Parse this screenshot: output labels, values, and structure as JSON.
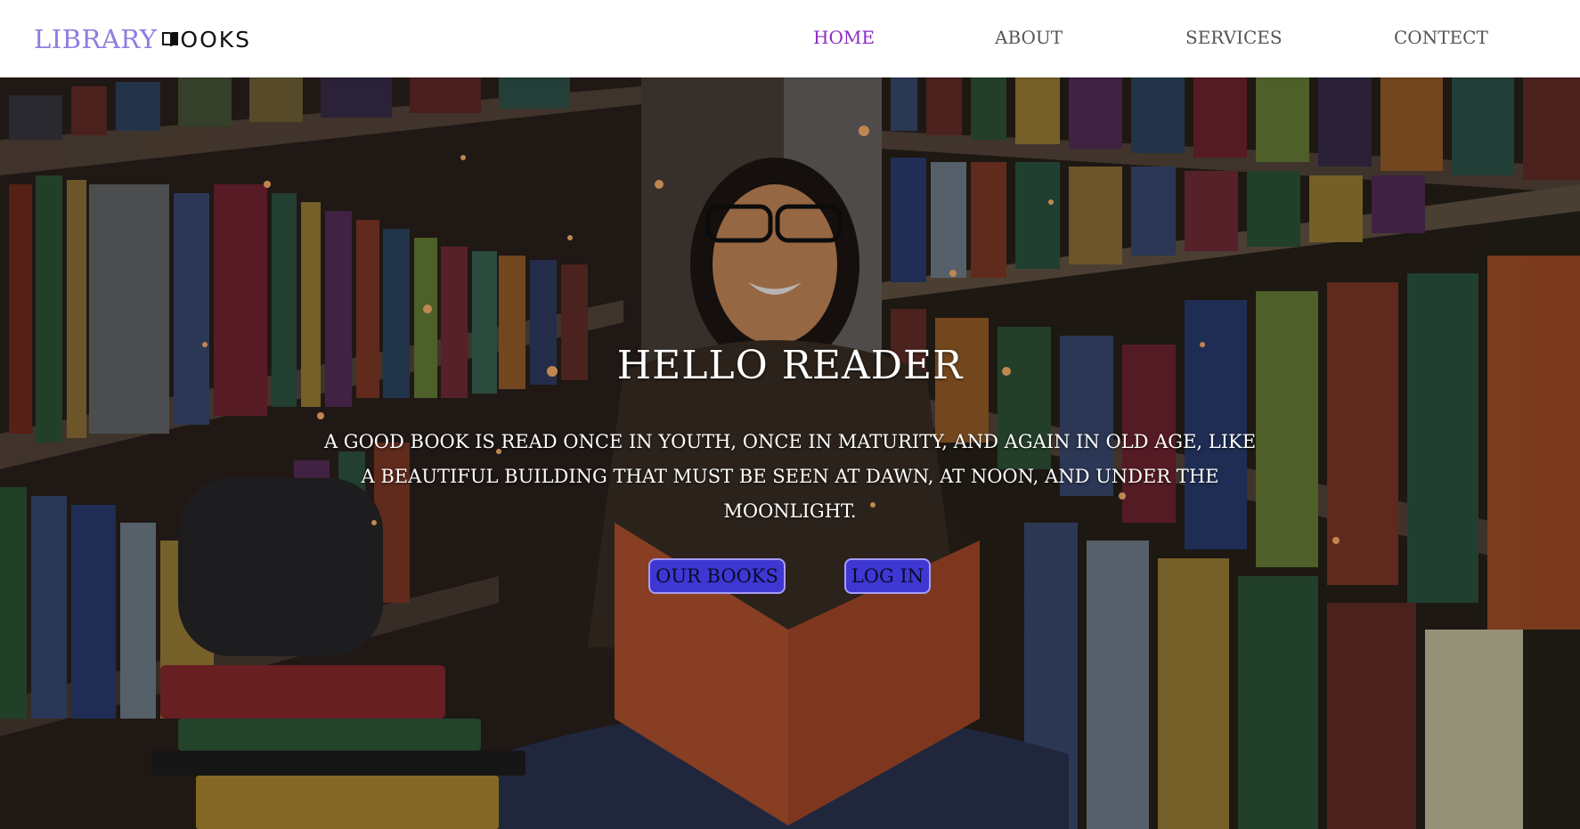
{
  "logo": {
    "library": "LIBRARY",
    "books": "OOKS"
  },
  "nav": {
    "items": [
      {
        "label": "HOME",
        "active": true
      },
      {
        "label": "ABOUT",
        "active": false
      },
      {
        "label": "SERVICES",
        "active": false
      },
      {
        "label": "CONTECT",
        "active": false
      }
    ]
  },
  "hero": {
    "title": "HELLO READER",
    "quote": "A GOOD BOOK IS READ ONCE IN YOUTH, ONCE IN MATURITY, AND AGAIN IN OLD AGE, LIKE A BEAUTIFUL BUILDING THAT MUST BE SEEN AT DAWN, AT NOON, AND UNDER THE MOONLIGHT.",
    "buttons": {
      "our_books": "OUR BOOKS",
      "log_in": "LOG IN"
    }
  },
  "colors": {
    "brand": "#8b7fe0",
    "nav_active": "#8a2bc4",
    "button_bg": "#3e37d1"
  }
}
